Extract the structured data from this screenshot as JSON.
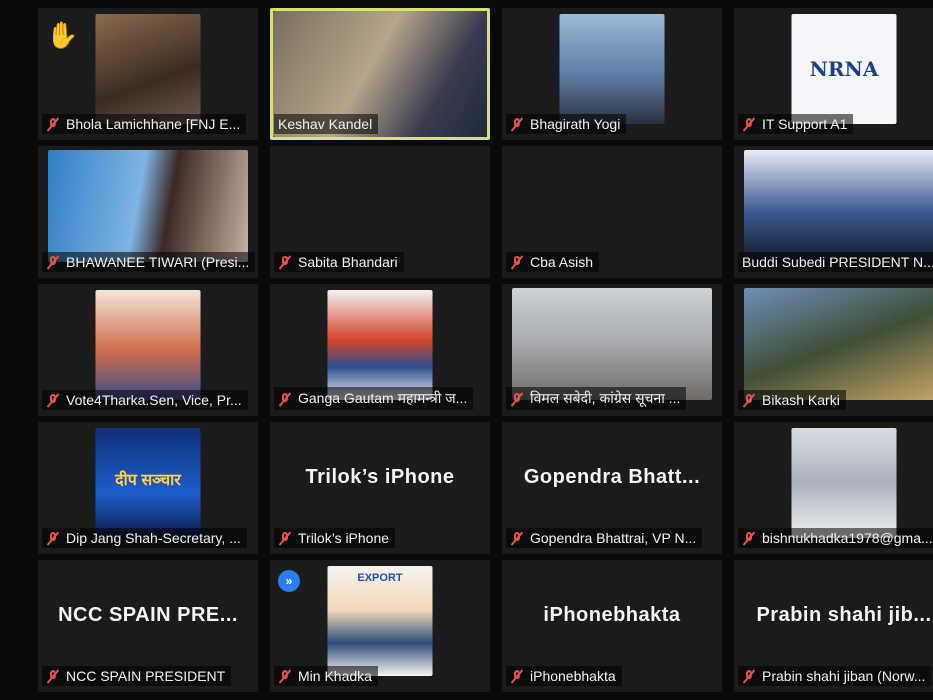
{
  "tiles": [
    {
      "name": "Bhola Lamichhane [FNJ E...",
      "type": "photo",
      "raised_hand": true
    },
    {
      "name": "Keshav Kandel",
      "type": "video",
      "active": true
    },
    {
      "name": "Bhagirath Yogi",
      "type": "photo"
    },
    {
      "name": "IT Support A1",
      "type": "logo",
      "logo_text": "NRNA"
    },
    {
      "name": "BHAWANEE TIWARI (Presi...",
      "type": "photo"
    },
    {
      "name": "Sabita Bhandari",
      "type": "dark"
    },
    {
      "name": "Cba Asish",
      "type": "dark"
    },
    {
      "name": "Buddi Subedi PRESIDENT  N...",
      "type": "photo"
    },
    {
      "name": "Vote4Tharka.Sen, Vice, Pr...",
      "type": "photo"
    },
    {
      "name": "Ganga Gautam महामन्त्री ज...",
      "type": "photo"
    },
    {
      "name": "विमल सबेदी,  कांग्रेस सूचना ...",
      "type": "photo"
    },
    {
      "name": "Bikash Karki",
      "type": "photo"
    },
    {
      "name": "Dip Jang Shah-Secretary, ...",
      "type": "photo",
      "overlay_text": "दीप सञ्चार"
    },
    {
      "name": "Trilok’s iPhone",
      "type": "name",
      "big_name": "Trilok’s iPhone"
    },
    {
      "name": "Gopendra Bhattrai, VP N...",
      "type": "name",
      "big_name": "Gopendra  Bhatt..."
    },
    {
      "name": "bishnukhadka1978@gma...",
      "type": "photo"
    },
    {
      "name": "NCC SPAIN PRESIDENT",
      "type": "name",
      "big_name": "NCC  SPAIN  PRE..."
    },
    {
      "name": "Min Khadka",
      "type": "photo",
      "overlay_text": "EXPORT",
      "badge": "»"
    },
    {
      "name": "iPhonebhakta",
      "type": "name",
      "big_name": "iPhonebhakta"
    },
    {
      "name": "Prabin shahi jiban (Norw...",
      "type": "name",
      "big_name": "Prabin shahi jib..."
    }
  ],
  "icons": {
    "muted": "microphone-muted-icon",
    "hand": "raised-hand-icon",
    "ff": "fast-forward-badge-icon"
  },
  "colors": {
    "active_border": "#d8e36a",
    "muted_red": "#e5534b",
    "tile_bg": "#1b1b1c"
  }
}
